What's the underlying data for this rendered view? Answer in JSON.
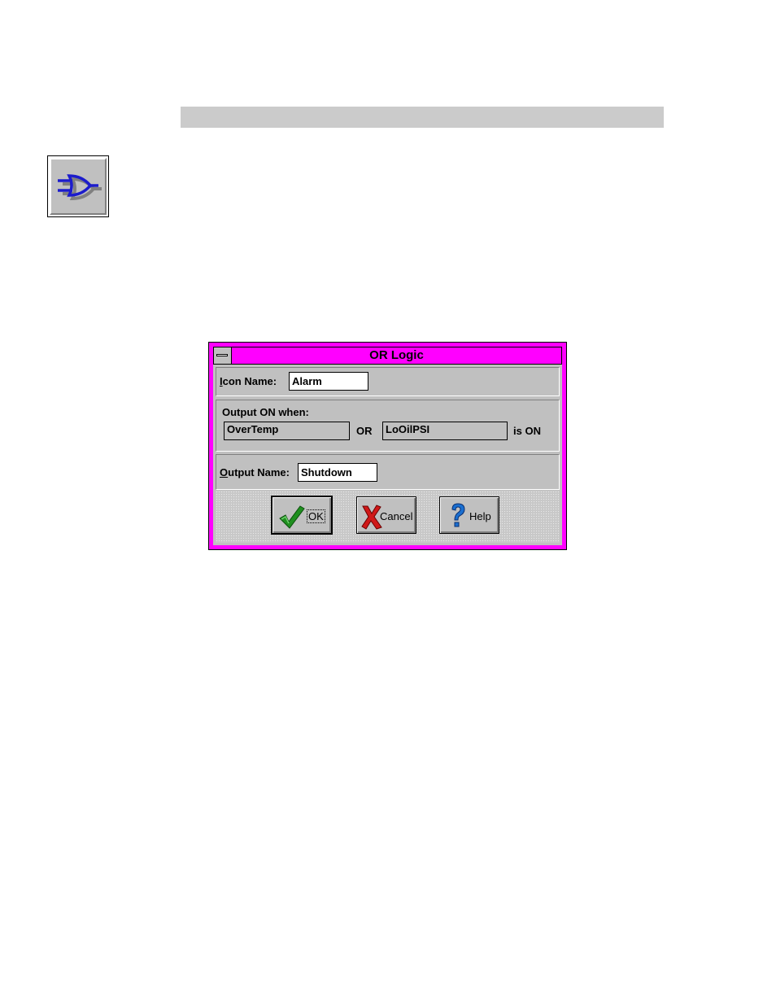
{
  "dialog": {
    "title": "OR Logic",
    "icon_name": {
      "label_accel": "I",
      "label_rest": "con Name:",
      "value": "Alarm"
    },
    "condition": {
      "heading": "Output ON when:",
      "input_a": "OverTemp",
      "operator": "OR",
      "input_b": "LoOilPSI",
      "suffix": "is ON"
    },
    "output_name": {
      "label_accel": "O",
      "label_rest": "utput Name:",
      "value": "Shutdown"
    },
    "buttons": {
      "ok": "OK",
      "cancel": "Cancel",
      "help": "Help"
    }
  },
  "icons": {
    "toolbar_icon": "or-gate-icon",
    "ok_icon": "green-check-icon",
    "cancel_icon": "red-x-icon",
    "help_icon": "question-mark-icon"
  },
  "colors": {
    "titlebar": "#ff00ff",
    "dialog_face": "#c0c0c0"
  }
}
